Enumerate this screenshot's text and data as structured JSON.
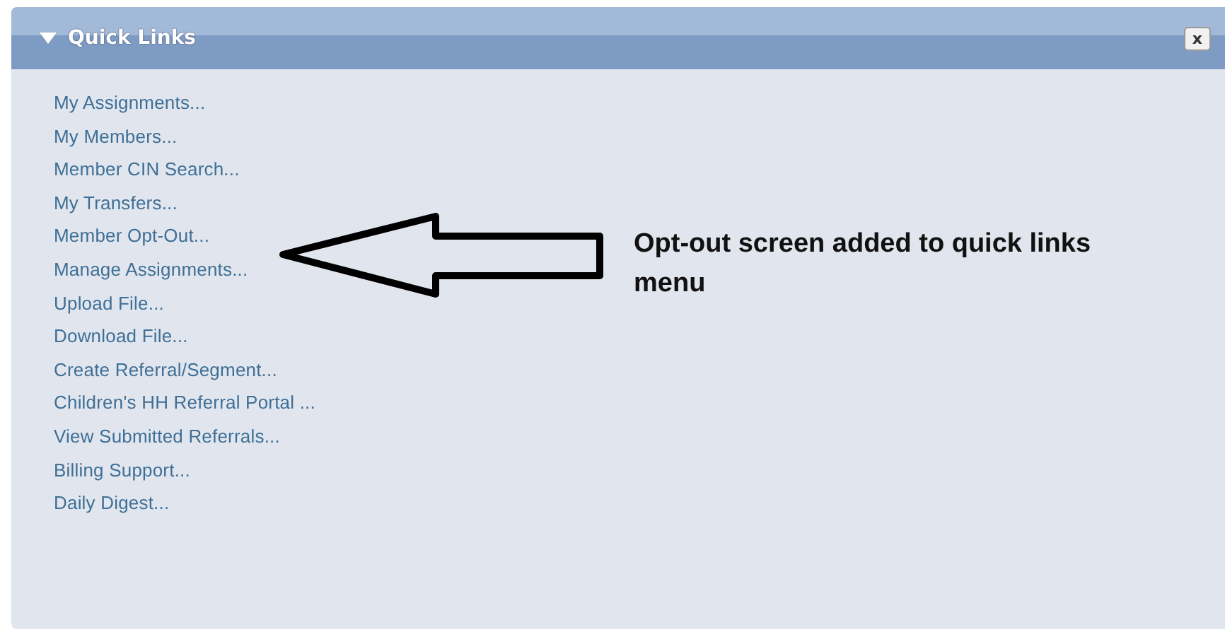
{
  "panel": {
    "title": "Quick Links",
    "expanded": true,
    "close_label": "x"
  },
  "links": [
    "My Assignments...",
    "My Members...",
    "Member CIN Search...",
    "My Transfers...",
    "Member Opt-Out...",
    "Manage Assignments...",
    "Upload File...",
    "Download File...",
    "Create Referral/Segment...",
    "Children's HH Referral Portal ...",
    "View Submitted Referrals...",
    "Billing Support...",
    "Daily Digest..."
  ],
  "annotation": {
    "text": "Opt-out screen added to quick links menu"
  }
}
